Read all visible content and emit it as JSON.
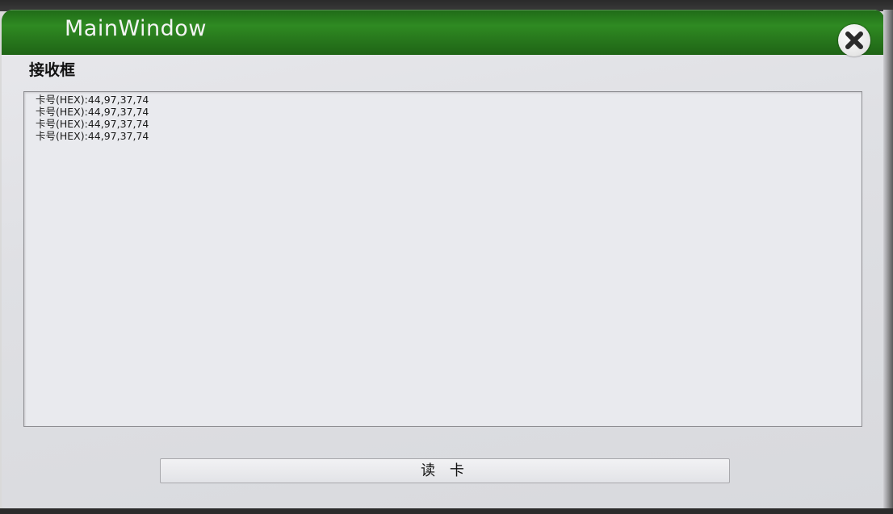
{
  "window": {
    "title": "MainWindow",
    "close_icon": "close-circle-x-icon",
    "accent_color": "#2f8a22"
  },
  "receive": {
    "label": "接收框",
    "lines": [
      "卡号(HEX):44,97,37,74",
      "卡号(HEX):44,97,37,74",
      "卡号(HEX):44,97,37,74",
      "卡号(HEX):44,97,37,74"
    ]
  },
  "actions": {
    "read_card_label": "读 卡"
  }
}
